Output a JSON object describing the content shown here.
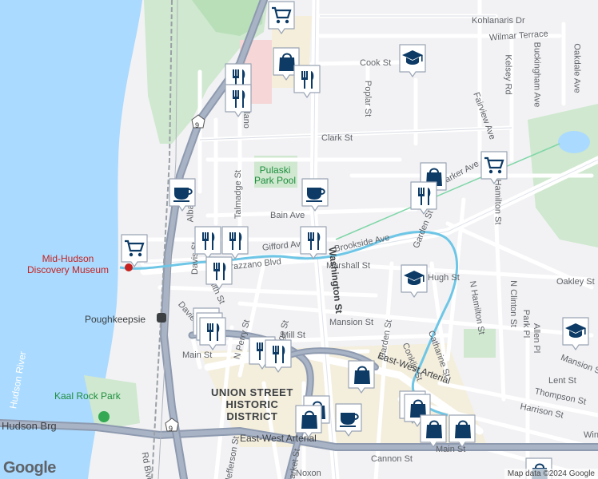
{
  "map": {
    "footer": {
      "logo": "Google",
      "attribution": "Map data ©2024 Google"
    },
    "colors": {
      "water": "#aadaff",
      "park": "#c8e6c9",
      "land": "#f2f2f4",
      "road": "#ffffff",
      "highway": "#8e9aaf",
      "marker_fill": "#ffffff",
      "marker_icon": "#0d3b66",
      "waterway": "#6ec6e6"
    },
    "areas": {
      "district": "UNION STREET\nHISTORIC\nDISTRICT",
      "park1": "Pulaski\nPark Pool",
      "park2": "Kaal Rock Park",
      "museum": "Mid-Hudson\nDiscovery Museum",
      "station": "Poughkeepsie",
      "river": "Hudson River"
    },
    "streets": [
      "Kohlanaris Dr",
      "Wilmar Terrace",
      "Oakdale Ave",
      "Cook St",
      "Poplar St",
      "Buckingham Ave",
      "Kelsey Rd",
      "Fairview Ave",
      "Clark St",
      "Parker Ave",
      "N Hamilton St",
      "Bain Ave",
      "Gifford Ave",
      "Brookside Ave",
      "Garden St",
      "Verrazzano Blvd",
      "Marshall St",
      "Washington St",
      "Mansion St",
      "Oakley St",
      "N Clinton St",
      "Mill St",
      "Main St",
      "Davies Pl",
      "N Perry St",
      "Conklin St",
      "Catharine St",
      "N Hamilton St",
      "Park Pl",
      "Allen Pl",
      "Mansion St",
      "Lent St",
      "Thompson St",
      "Harrison St",
      "East-West Arterial",
      "East-West Arterial",
      "Cannon St",
      "Main St",
      "Hudson Brg",
      "Jefferson St",
      "Market St",
      "Noxon",
      "Delano",
      "Talmadge St",
      "Davis St",
      "Albany",
      "Smith St",
      "Bridge St",
      "Garden St",
      "Rd Blvd",
      "Hugh St",
      "Win"
    ],
    "route_shields": [
      "9",
      "9"
    ],
    "markers": [
      {
        "type": "shopping-cart"
      },
      {
        "type": "shopping-bag"
      },
      {
        "type": "restaurant"
      },
      {
        "type": "restaurant"
      },
      {
        "type": "restaurant"
      },
      {
        "type": "school"
      },
      {
        "type": "coffee"
      },
      {
        "type": "coffee"
      },
      {
        "type": "shopping-bag"
      },
      {
        "type": "restaurant"
      },
      {
        "type": "shopping-cart"
      },
      {
        "type": "restaurant"
      },
      {
        "type": "restaurant"
      },
      {
        "type": "restaurant"
      },
      {
        "type": "restaurant"
      },
      {
        "type": "shopping-cart"
      },
      {
        "type": "school"
      },
      {
        "type": "restaurant"
      },
      {
        "type": "restaurant"
      },
      {
        "type": "restaurant"
      },
      {
        "type": "restaurant"
      },
      {
        "type": "restaurant"
      },
      {
        "type": "shopping-bag"
      },
      {
        "type": "school"
      },
      {
        "type": "shopping-bag"
      },
      {
        "type": "shopping-bag"
      },
      {
        "type": "coffee"
      },
      {
        "type": "shopping-bag"
      },
      {
        "type": "shopping-bag"
      },
      {
        "type": "shopping-bag"
      },
      {
        "type": "shopping-bag"
      },
      {
        "type": "shopping-bag"
      }
    ]
  }
}
